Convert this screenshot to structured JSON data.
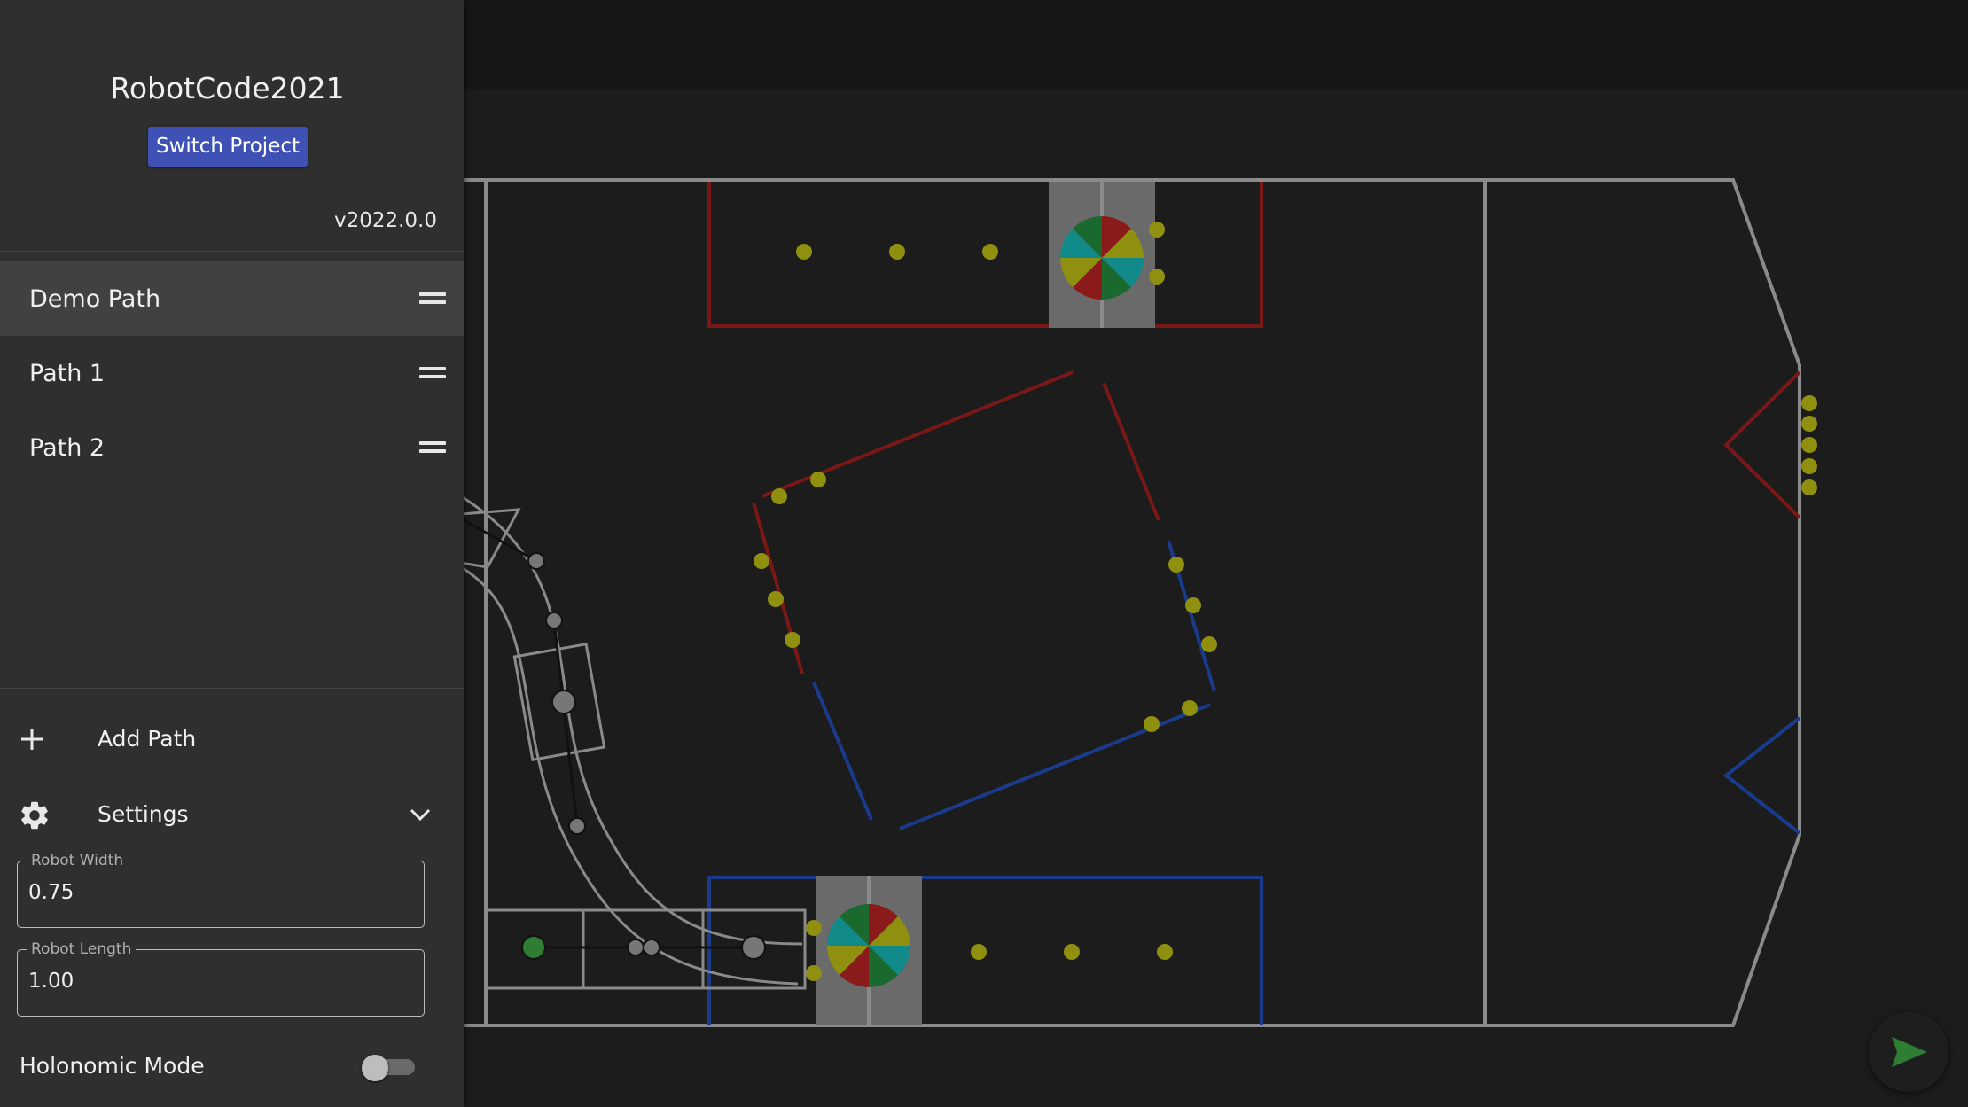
{
  "sidebar": {
    "project_title": "RobotCode2021",
    "switch_project_label": "Switch Project",
    "version": "v2022.0.0",
    "paths": [
      {
        "label": "Demo Path",
        "selected": true
      },
      {
        "label": "Path 1",
        "selected": false
      },
      {
        "label": "Path 2",
        "selected": false
      }
    ],
    "add_path_label": "Add Path",
    "settings_label": "Settings",
    "settings_expanded": true,
    "robot_width": {
      "label": "Robot Width",
      "value": "0.75"
    },
    "robot_length": {
      "label": "Robot Length",
      "value": "1.00"
    },
    "holonomic_mode": {
      "label": "Holonomic Mode",
      "enabled": false
    }
  },
  "window_controls": {
    "minimize_icon": "minimize-icon",
    "maximize_icon": "maximize-icon",
    "close_icon": "close-icon"
  },
  "colors": {
    "accent": "#3f51b5",
    "sidebar_bg": "#2f2f2f",
    "field_bg": "#1c1c1c",
    "field_lines": "#8a8a8a",
    "red_alliance": "#8b1a1a",
    "blue_alliance": "#1a3a8b",
    "power_cell": "#8f8f10",
    "start_point": "#2e7d32",
    "generate_icon": "#2e7d32"
  }
}
